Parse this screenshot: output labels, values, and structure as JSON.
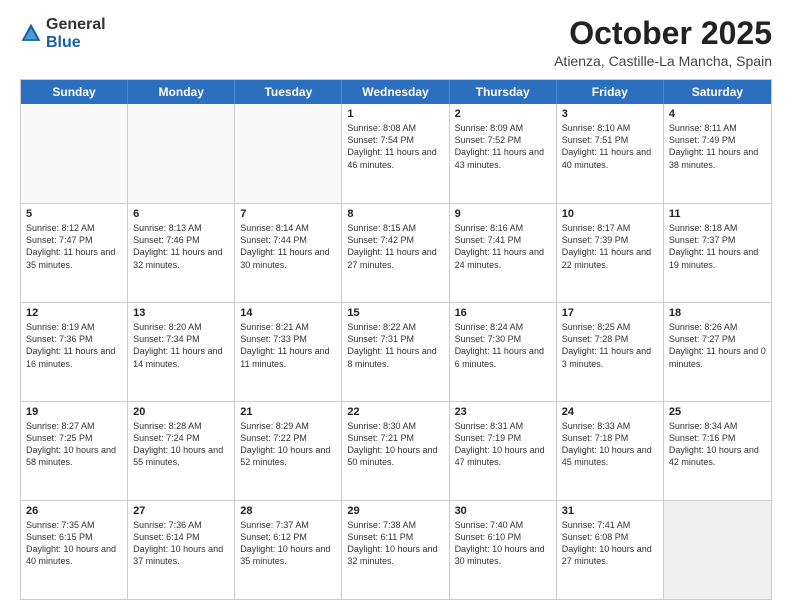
{
  "logo": {
    "general": "General",
    "blue": "Blue"
  },
  "header": {
    "month": "October 2025",
    "location": "Atienza, Castille-La Mancha, Spain"
  },
  "weekdays": [
    "Sunday",
    "Monday",
    "Tuesday",
    "Wednesday",
    "Thursday",
    "Friday",
    "Saturday"
  ],
  "rows": [
    [
      {
        "day": "",
        "text": "",
        "empty": true
      },
      {
        "day": "",
        "text": "",
        "empty": true
      },
      {
        "day": "",
        "text": "",
        "empty": true
      },
      {
        "day": "1",
        "text": "Sunrise: 8:08 AM\nSunset: 7:54 PM\nDaylight: 11 hours and 46 minutes."
      },
      {
        "day": "2",
        "text": "Sunrise: 8:09 AM\nSunset: 7:52 PM\nDaylight: 11 hours and 43 minutes."
      },
      {
        "day": "3",
        "text": "Sunrise: 8:10 AM\nSunset: 7:51 PM\nDaylight: 11 hours and 40 minutes."
      },
      {
        "day": "4",
        "text": "Sunrise: 8:11 AM\nSunset: 7:49 PM\nDaylight: 11 hours and 38 minutes."
      }
    ],
    [
      {
        "day": "5",
        "text": "Sunrise: 8:12 AM\nSunset: 7:47 PM\nDaylight: 11 hours and 35 minutes."
      },
      {
        "day": "6",
        "text": "Sunrise: 8:13 AM\nSunset: 7:46 PM\nDaylight: 11 hours and 32 minutes."
      },
      {
        "day": "7",
        "text": "Sunrise: 8:14 AM\nSunset: 7:44 PM\nDaylight: 11 hours and 30 minutes."
      },
      {
        "day": "8",
        "text": "Sunrise: 8:15 AM\nSunset: 7:42 PM\nDaylight: 11 hours and 27 minutes."
      },
      {
        "day": "9",
        "text": "Sunrise: 8:16 AM\nSunset: 7:41 PM\nDaylight: 11 hours and 24 minutes."
      },
      {
        "day": "10",
        "text": "Sunrise: 8:17 AM\nSunset: 7:39 PM\nDaylight: 11 hours and 22 minutes."
      },
      {
        "day": "11",
        "text": "Sunrise: 8:18 AM\nSunset: 7:37 PM\nDaylight: 11 hours and 19 minutes."
      }
    ],
    [
      {
        "day": "12",
        "text": "Sunrise: 8:19 AM\nSunset: 7:36 PM\nDaylight: 11 hours and 16 minutes."
      },
      {
        "day": "13",
        "text": "Sunrise: 8:20 AM\nSunset: 7:34 PM\nDaylight: 11 hours and 14 minutes."
      },
      {
        "day": "14",
        "text": "Sunrise: 8:21 AM\nSunset: 7:33 PM\nDaylight: 11 hours and 11 minutes."
      },
      {
        "day": "15",
        "text": "Sunrise: 8:22 AM\nSunset: 7:31 PM\nDaylight: 11 hours and 8 minutes."
      },
      {
        "day": "16",
        "text": "Sunrise: 8:24 AM\nSunset: 7:30 PM\nDaylight: 11 hours and 6 minutes."
      },
      {
        "day": "17",
        "text": "Sunrise: 8:25 AM\nSunset: 7:28 PM\nDaylight: 11 hours and 3 minutes."
      },
      {
        "day": "18",
        "text": "Sunrise: 8:26 AM\nSunset: 7:27 PM\nDaylight: 11 hours and 0 minutes."
      }
    ],
    [
      {
        "day": "19",
        "text": "Sunrise: 8:27 AM\nSunset: 7:25 PM\nDaylight: 10 hours and 58 minutes."
      },
      {
        "day": "20",
        "text": "Sunrise: 8:28 AM\nSunset: 7:24 PM\nDaylight: 10 hours and 55 minutes."
      },
      {
        "day": "21",
        "text": "Sunrise: 8:29 AM\nSunset: 7:22 PM\nDaylight: 10 hours and 52 minutes."
      },
      {
        "day": "22",
        "text": "Sunrise: 8:30 AM\nSunset: 7:21 PM\nDaylight: 10 hours and 50 minutes."
      },
      {
        "day": "23",
        "text": "Sunrise: 8:31 AM\nSunset: 7:19 PM\nDaylight: 10 hours and 47 minutes."
      },
      {
        "day": "24",
        "text": "Sunrise: 8:33 AM\nSunset: 7:18 PM\nDaylight: 10 hours and 45 minutes."
      },
      {
        "day": "25",
        "text": "Sunrise: 8:34 AM\nSunset: 7:16 PM\nDaylight: 10 hours and 42 minutes."
      }
    ],
    [
      {
        "day": "26",
        "text": "Sunrise: 7:35 AM\nSunset: 6:15 PM\nDaylight: 10 hours and 40 minutes."
      },
      {
        "day": "27",
        "text": "Sunrise: 7:36 AM\nSunset: 6:14 PM\nDaylight: 10 hours and 37 minutes."
      },
      {
        "day": "28",
        "text": "Sunrise: 7:37 AM\nSunset: 6:12 PM\nDaylight: 10 hours and 35 minutes."
      },
      {
        "day": "29",
        "text": "Sunrise: 7:38 AM\nSunset: 6:11 PM\nDaylight: 10 hours and 32 minutes."
      },
      {
        "day": "30",
        "text": "Sunrise: 7:40 AM\nSunset: 6:10 PM\nDaylight: 10 hours and 30 minutes."
      },
      {
        "day": "31",
        "text": "Sunrise: 7:41 AM\nSunset: 6:08 PM\nDaylight: 10 hours and 27 minutes."
      },
      {
        "day": "",
        "text": "",
        "empty": true,
        "shaded": true
      }
    ]
  ]
}
